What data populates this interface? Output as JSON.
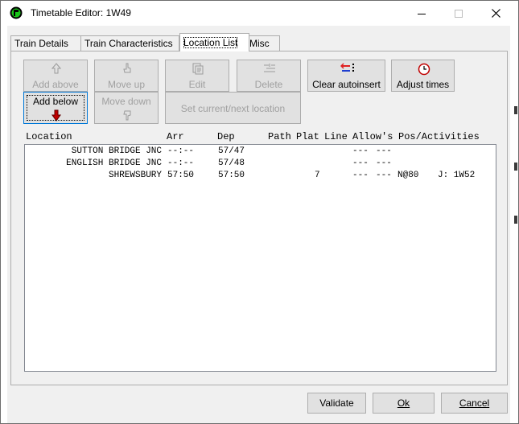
{
  "window": {
    "title": "Timetable Editor: 1W49"
  },
  "tabs": [
    {
      "label": "Train Details",
      "active": false
    },
    {
      "label": "Train Characteristics",
      "active": false
    },
    {
      "label": "Location List",
      "active": true
    },
    {
      "label": "Misc",
      "active": false
    }
  ],
  "toolbar": {
    "add_above": "Add above",
    "move_up": "Move up",
    "edit": "Edit",
    "delete": "Delete",
    "clear_autoinsert": "Clear autoinsert",
    "adjust_times": "Adjust times",
    "add_below": "Add below",
    "move_down": "Move down",
    "set_current": "Set current/next location"
  },
  "list": {
    "headers": {
      "location": "Location",
      "arr": "Arr",
      "dep": "Dep",
      "path": "Path",
      "plat": "Plat",
      "line": "Line",
      "allows": "Allow's",
      "pos": "Pos/Activities"
    },
    "rows": [
      {
        "location": "SUTTON BRIDGE JNC",
        "arr": "--:--",
        "dep": "57/47",
        "plat": "",
        "allow1": "---",
        "allow2": "---",
        "pos": "",
        "activity": ""
      },
      {
        "location": "ENGLISH BRIDGE JNC",
        "arr": "--:--",
        "dep": "57/48",
        "plat": "",
        "allow1": "---",
        "allow2": "---",
        "pos": "",
        "activity": ""
      },
      {
        "location": "SHREWSBURY",
        "arr": "57:50",
        "dep": "57:50",
        "plat": "7",
        "allow1": "---",
        "allow2": "---",
        "pos": "N@80",
        "activity": "J: 1W52"
      }
    ]
  },
  "footer": {
    "validate": "Validate",
    "ok": "Ok",
    "cancel": "Cancel"
  }
}
